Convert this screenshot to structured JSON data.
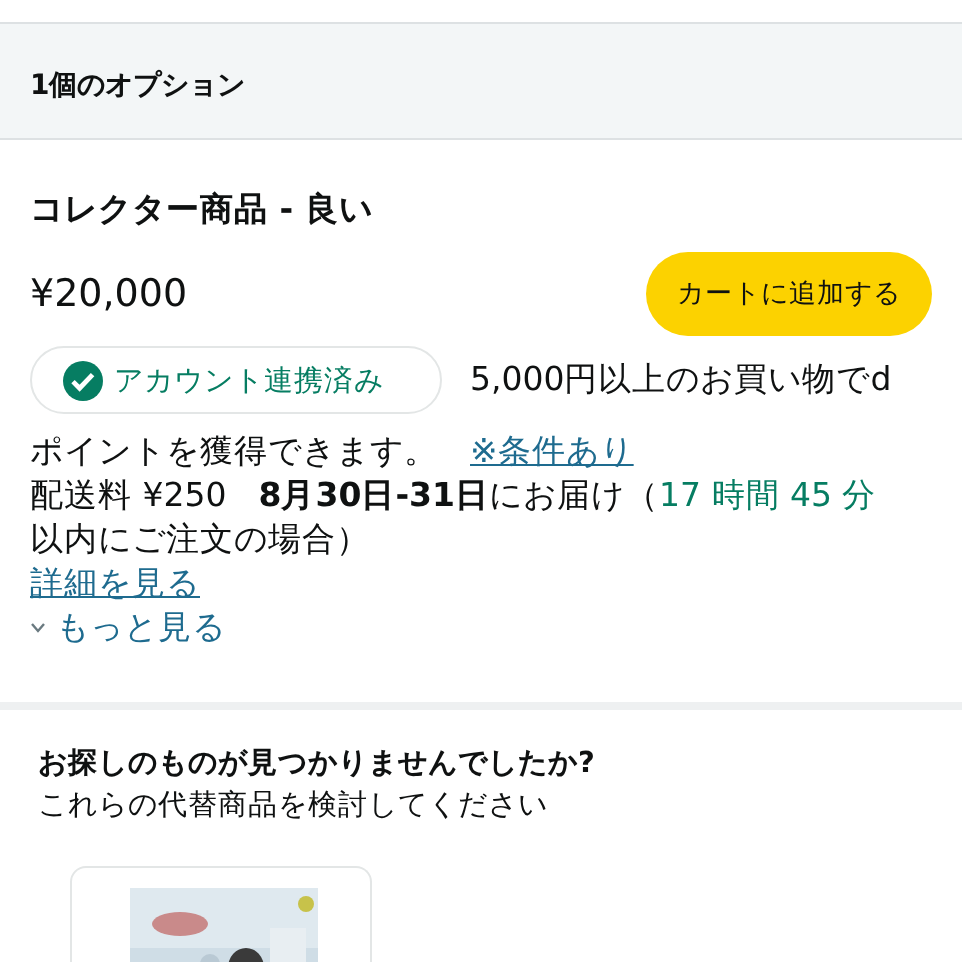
{
  "options_header": {
    "title": "1個のオプション"
  },
  "offer": {
    "condition": "コレクター商品 - 良い",
    "price": "¥20,000",
    "add_to_cart": "カートに追加する",
    "badge": {
      "label": "アカウント連携済み",
      "verified": true
    },
    "points_note": "5,000円以上のお買い物でd",
    "points_note_cont": "ポイントを獲得できます。",
    "terms_link": "※条件あり",
    "delivery": {
      "fee": "配送料 ¥250",
      "date": "8月30日-31日",
      "after_date": "にお届け（",
      "countdown": "17 時間 45 分",
      "condition": "以内にご注文の場合）"
    },
    "details_link": "詳細を見る",
    "more_link": "もっと見る"
  },
  "alternatives": {
    "title": "お探しのものが見つかりませんでしたか?",
    "subtitle": "これらの代替商品を検討してください"
  }
}
